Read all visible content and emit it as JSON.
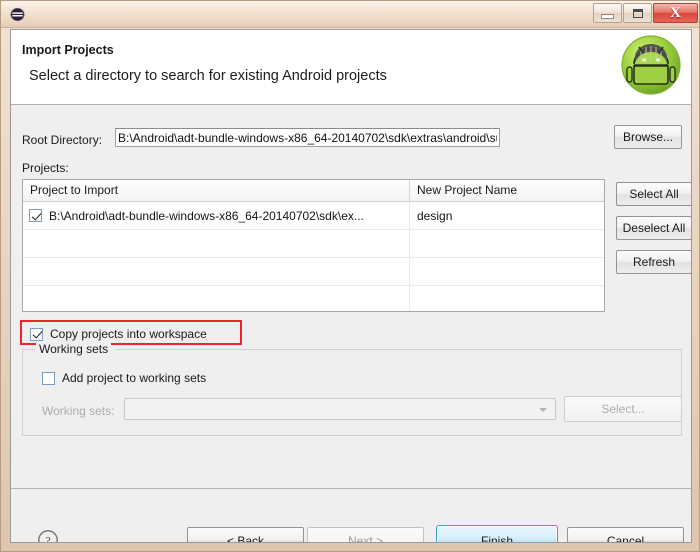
{
  "window": {
    "app_icon": "eclipse-icon",
    "title": "",
    "controls": {
      "minimize": "minimize-icon",
      "maximize": "maximize-icon",
      "close": "X"
    }
  },
  "header": {
    "title": "Import Projects",
    "subtitle": "Select a directory to search for existing Android projects",
    "logo": "android-robot-icon"
  },
  "form": {
    "root_directory_label": "Root Directory:",
    "root_directory_value": "B:\\Android\\adt-bundle-windows-x86_64-20140702\\sdk\\extras\\android\\support\\de",
    "root_directory_placeholder": "",
    "browse_label": "Browse...",
    "projects_label": "Projects:"
  },
  "table": {
    "columns": [
      "Project to Import",
      "New Project Name"
    ],
    "rows": [
      {
        "checked": true,
        "project": "B:\\Android\\adt-bundle-windows-x86_64-20140702\\sdk\\ex...",
        "name": "design"
      },
      {
        "checked": null,
        "project": "",
        "name": ""
      },
      {
        "checked": null,
        "project": "",
        "name": ""
      },
      {
        "checked": null,
        "project": "",
        "name": ""
      }
    ]
  },
  "side_buttons": {
    "select_all": "Select All",
    "deselect_all": "Deselect All",
    "refresh": "Refresh"
  },
  "options": {
    "copy_projects_label": "Copy projects into workspace",
    "copy_projects_checked": true
  },
  "working_sets": {
    "legend": "Working sets",
    "add_project_label": "Add project to working sets",
    "add_project_checked": false,
    "field_label": "Working sets:",
    "combo_value": "",
    "select_label": "Select..."
  },
  "footer": {
    "help": "?",
    "back": "< Back",
    "next": "Next >",
    "finish": "Finish",
    "cancel": "Cancel"
  },
  "annotation": {
    "color": "#e8262c",
    "target": "copy-projects-into-workspace"
  }
}
